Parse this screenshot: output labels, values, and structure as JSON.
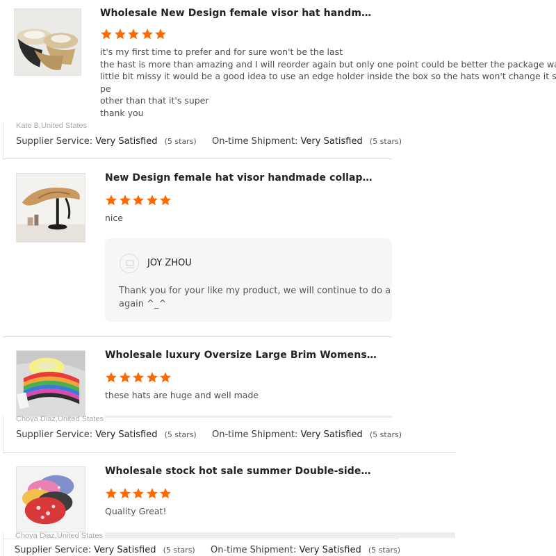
{
  "reviews": [
    {
      "product_title": "Wholesale New Design female visor hat handm…",
      "rating_stars": 5,
      "comment_lines": [
        "it's my first time to prefer and for sure won't be the last",
        "the hast is more than amazing and I will reorder again but only one point could be better the package was a",
        "little bit missy it would be a good idea to use an edge holder inside the box so the hats won't change it sha",
        "pe",
        "other than that it's super",
        "thank you"
      ],
      "reviewer": "Kate B,United States",
      "supplier_service_label": "Supplier Service:",
      "supplier_service_value": "Very Satisfied",
      "supplier_service_stars": "(5 stars)",
      "shipment_label": "On-time Shipment:",
      "shipment_value": "Very Satisfied",
      "shipment_stars": "(5 stars)",
      "thumb_icon": "straw-visor-hats-image"
    },
    {
      "product_title": "New Design female hat visor handmade collap…",
      "rating_stars": 5,
      "comment_lines": [
        "nice"
      ],
      "reply": {
        "name": "JOY ZHOU",
        "avatar_icon": "supplier-avatar-icon",
        "text_lines": [
          "Thank you for your like my product, we will continue to do a good",
          "again ^_^"
        ]
      },
      "thumb_icon": "tan-visor-hat-on-stand-image"
    },
    {
      "product_title": "Wholesale luxury Oversize Large Brim Womens…",
      "rating_stars": 5,
      "comment_lines": [
        "these hats are huge and well made"
      ],
      "reviewer": "Choya Diaz,United States",
      "supplier_service_label": "Supplier Service:",
      "supplier_service_value": "Very Satisfied",
      "supplier_service_stars": "(5 stars)",
      "shipment_label": "On-time Shipment:",
      "shipment_value": "Very Satisfied",
      "shipment_stars": "(5 stars)",
      "thumb_icon": "colorful-brim-hats-image"
    },
    {
      "product_title": "Wholesale stock hot sale summer Double-side…",
      "rating_stars": 5,
      "comment_lines": [
        "Quality Great!"
      ],
      "reviewer": "Choya Diaz,United States",
      "supplier_service_label": "Supplier Service:",
      "supplier_service_value": "Very Satisfied",
      "supplier_service_stars": "(5 stars)",
      "shipment_label": "On-time Shipment:",
      "shipment_value": "Very Satisfied",
      "shipment_stars": "(5 stars)",
      "thumb_icon": "bandana-bucket-hats-image"
    }
  ],
  "colors": {
    "star": "#ff6a00",
    "reply_background": "#f5f6f7",
    "divider": "#dcdcdc"
  }
}
